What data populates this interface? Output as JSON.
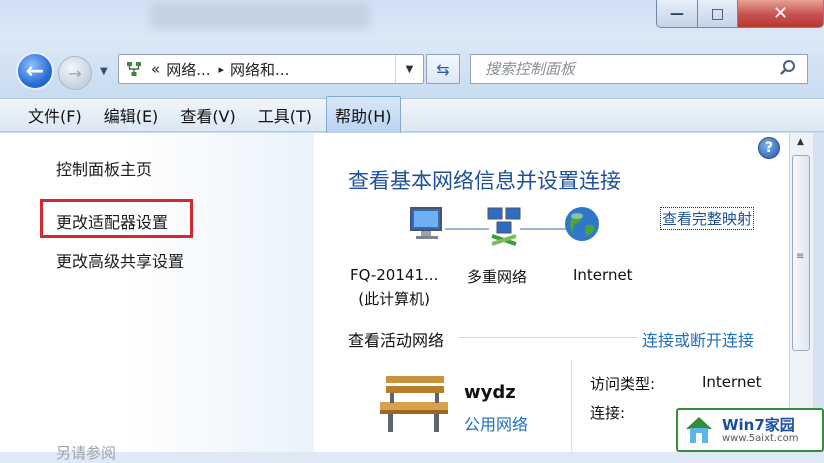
{
  "window": {
    "caption_buttons": {
      "minimize": "—",
      "maximize": "□",
      "close": "✕"
    }
  },
  "nav": {
    "back_icon": "back-arrow-icon",
    "forward_icon": "forward-arrow-icon",
    "address": {
      "prefix": "«",
      "segments": [
        "网络...",
        "网络和..."
      ],
      "separator": "▸"
    },
    "search_placeholder": "搜索控制面板"
  },
  "menu": {
    "items": [
      "文件(F)",
      "编辑(E)",
      "查看(V)",
      "工具(T)",
      "帮助(H)"
    ],
    "active_index": 4
  },
  "sidebar": {
    "items": [
      "控制面板主页",
      "更改适配器设置",
      "更改高级共享设置"
    ],
    "highlighted_index": 1,
    "footer_faded": "另请参阅"
  },
  "main": {
    "title": "查看基本网络信息并设置连接",
    "view_full_map": "查看完整映射",
    "map_nodes": [
      {
        "label_line1": "FQ-20141...",
        "label_line2": "(此计算机)"
      },
      {
        "label_line1": "多重网络",
        "label_line2": ""
      },
      {
        "label_line1": "Internet",
        "label_line2": ""
      }
    ],
    "active_section_title": "查看活动网络",
    "connect_link": "连接或断开连接",
    "network": {
      "name": "wydz",
      "type": "公用网络",
      "access_type_label": "访问类型:",
      "access_type_value": "Internet",
      "connection_label": "连接:"
    }
  },
  "watermark": {
    "line1": "Win7家园",
    "line2": "www.5aixt.com"
  },
  "colors": {
    "accent_blue": "#1e4f9a",
    "link_blue": "#1e6fc0",
    "highlight_red": "#d9272e"
  }
}
